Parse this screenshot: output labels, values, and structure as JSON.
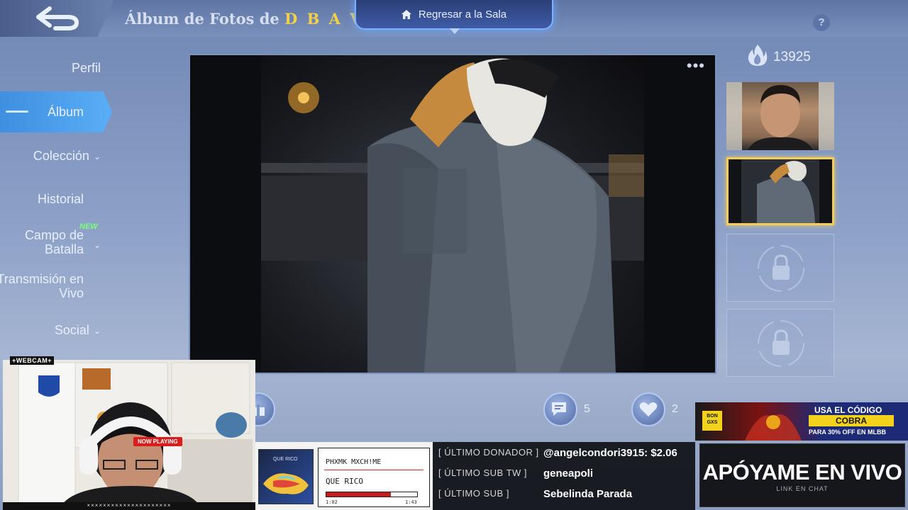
{
  "topbar": {
    "album_prefix": "Álbum de Fotos de ",
    "album_owner": "D B A V.... 2",
    "return_hall": "Regresar a la Sala",
    "help": "?"
  },
  "sidebar": {
    "items": [
      {
        "label": "Perfil"
      },
      {
        "label": "Álbum"
      },
      {
        "label": "Colección"
      },
      {
        "label": "Historial"
      },
      {
        "label": "Campo de Batalla",
        "badge": "NEW"
      },
      {
        "label": "Transmisión en Vivo"
      },
      {
        "label": "Social"
      }
    ]
  },
  "photo": {
    "more": "•••"
  },
  "popularity": {
    "count": "13925"
  },
  "actions": {
    "comments_count": "5",
    "likes_count": "2"
  },
  "overlay": {
    "webcam_label": "+WEBCAM+",
    "webcam_strip": "×××××××××××××××××××××",
    "now_playing": {
      "badge": "NOW PLAYING",
      "artist": "PHXMK MXCH!ME",
      "song": "QUE RICO",
      "art_title": "QUE RICO",
      "time_current": "1:02",
      "time_total": "1:43",
      "progress": 0.71
    },
    "stats": [
      {
        "label": "[ ÚLTIMO DONADOR ]",
        "value": "@angelcondori3915: $2.06"
      },
      {
        "label": "[ ÚLTIMO SUB TW ]",
        "value": "geneapoli"
      },
      {
        "label": "[ ÚLTIMO SUB ]",
        "value": "Sebelinda Parada"
      }
    ],
    "promo": {
      "logo": "BON GXS",
      "line1": "USA EL CÓDIGO",
      "code": "COBRA",
      "line3": "PARA 30% OFF EN MLBB"
    },
    "support": {
      "title": "APÓYAME EN VIVO",
      "subtitle": "LINK EN CHAT"
    }
  },
  "colors": {
    "accent": "#4aa3f0",
    "gold": "#f2cc5c",
    "brand_red": "#c51d1d"
  }
}
